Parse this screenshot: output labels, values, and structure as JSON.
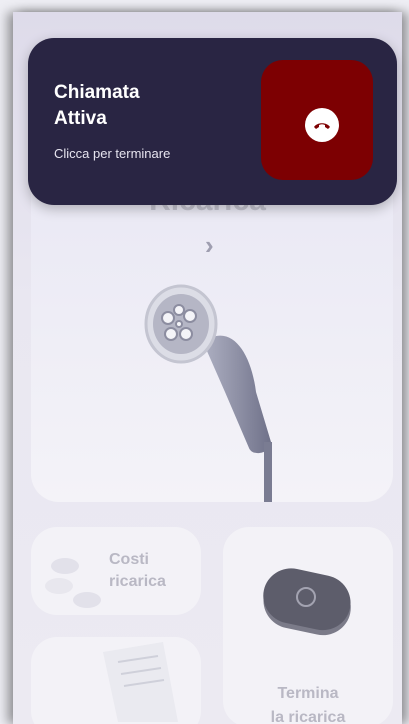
{
  "card": {
    "title": "Ricarica"
  },
  "costi": {
    "label_line1": "Costi",
    "label_line2": "ricarica"
  },
  "termina": {
    "label_line1": "Termina",
    "label_line2": "la ricarica"
  },
  "call": {
    "title_line1": "Chiamata",
    "title_line2": "Attiva",
    "subtitle": "Clicca per terminare"
  },
  "colors": {
    "call_bg": "#292543",
    "end_button": "#7d0002",
    "accent": "#ffffff"
  }
}
